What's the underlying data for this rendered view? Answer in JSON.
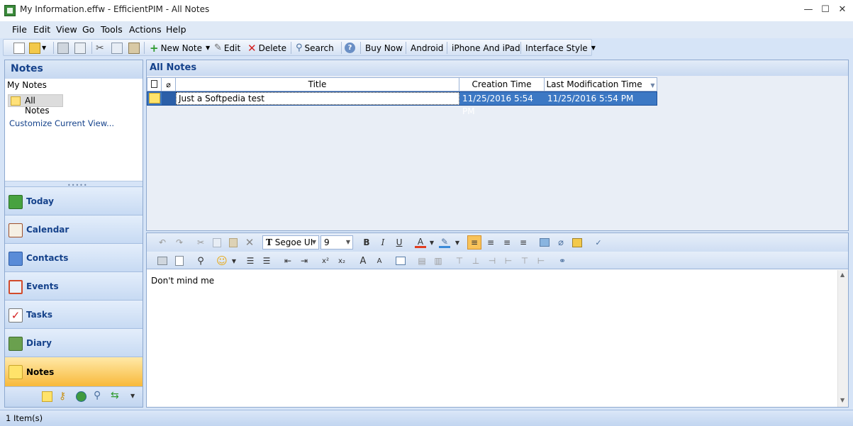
{
  "window": {
    "title": "My Information.effw - EfficientPIM - All Notes"
  },
  "menu": [
    "File",
    "Edit",
    "View",
    "Go",
    "Tools",
    "Actions",
    "Help"
  ],
  "toolbar": {
    "new_note": "New Note",
    "edit": "Edit",
    "delete": "Delete",
    "search": "Search",
    "buy_now": "Buy Now",
    "android": "Android",
    "iphone_ipad": "iPhone And iPad",
    "interface_style": "Interface Style"
  },
  "left_pane": {
    "header": "Notes",
    "group_label": "My Notes",
    "selected_item": "All Notes",
    "customize_link": "Customize Current View...",
    "nav": [
      {
        "label": "Today",
        "icon": "home-icon"
      },
      {
        "label": "Calendar",
        "icon": "calendar-icon"
      },
      {
        "label": "Contacts",
        "icon": "contacts-icon"
      },
      {
        "label": "Events",
        "icon": "events-icon"
      },
      {
        "label": "Tasks",
        "icon": "tasks-icon"
      },
      {
        "label": "Diary",
        "icon": "diary-icon"
      },
      {
        "label": "Notes",
        "icon": "notes-icon",
        "active": true
      }
    ]
  },
  "list": {
    "header": "All Notes",
    "columns": [
      "Title",
      "Creation Time",
      "Last Modification Time"
    ],
    "rows": [
      {
        "title": "Just a Softpedia test",
        "created": "11/25/2016 5:54 PM",
        "modified": "11/25/2016 5:54 PM"
      }
    ]
  },
  "editor": {
    "font": "Segoe UI",
    "size": "9",
    "content": "Don't mind me"
  },
  "status": {
    "text": "1 Item(s)"
  },
  "colors": {
    "accent": "#15428b",
    "selection": "#3c78c4",
    "active_nav": "#f8b93a"
  }
}
